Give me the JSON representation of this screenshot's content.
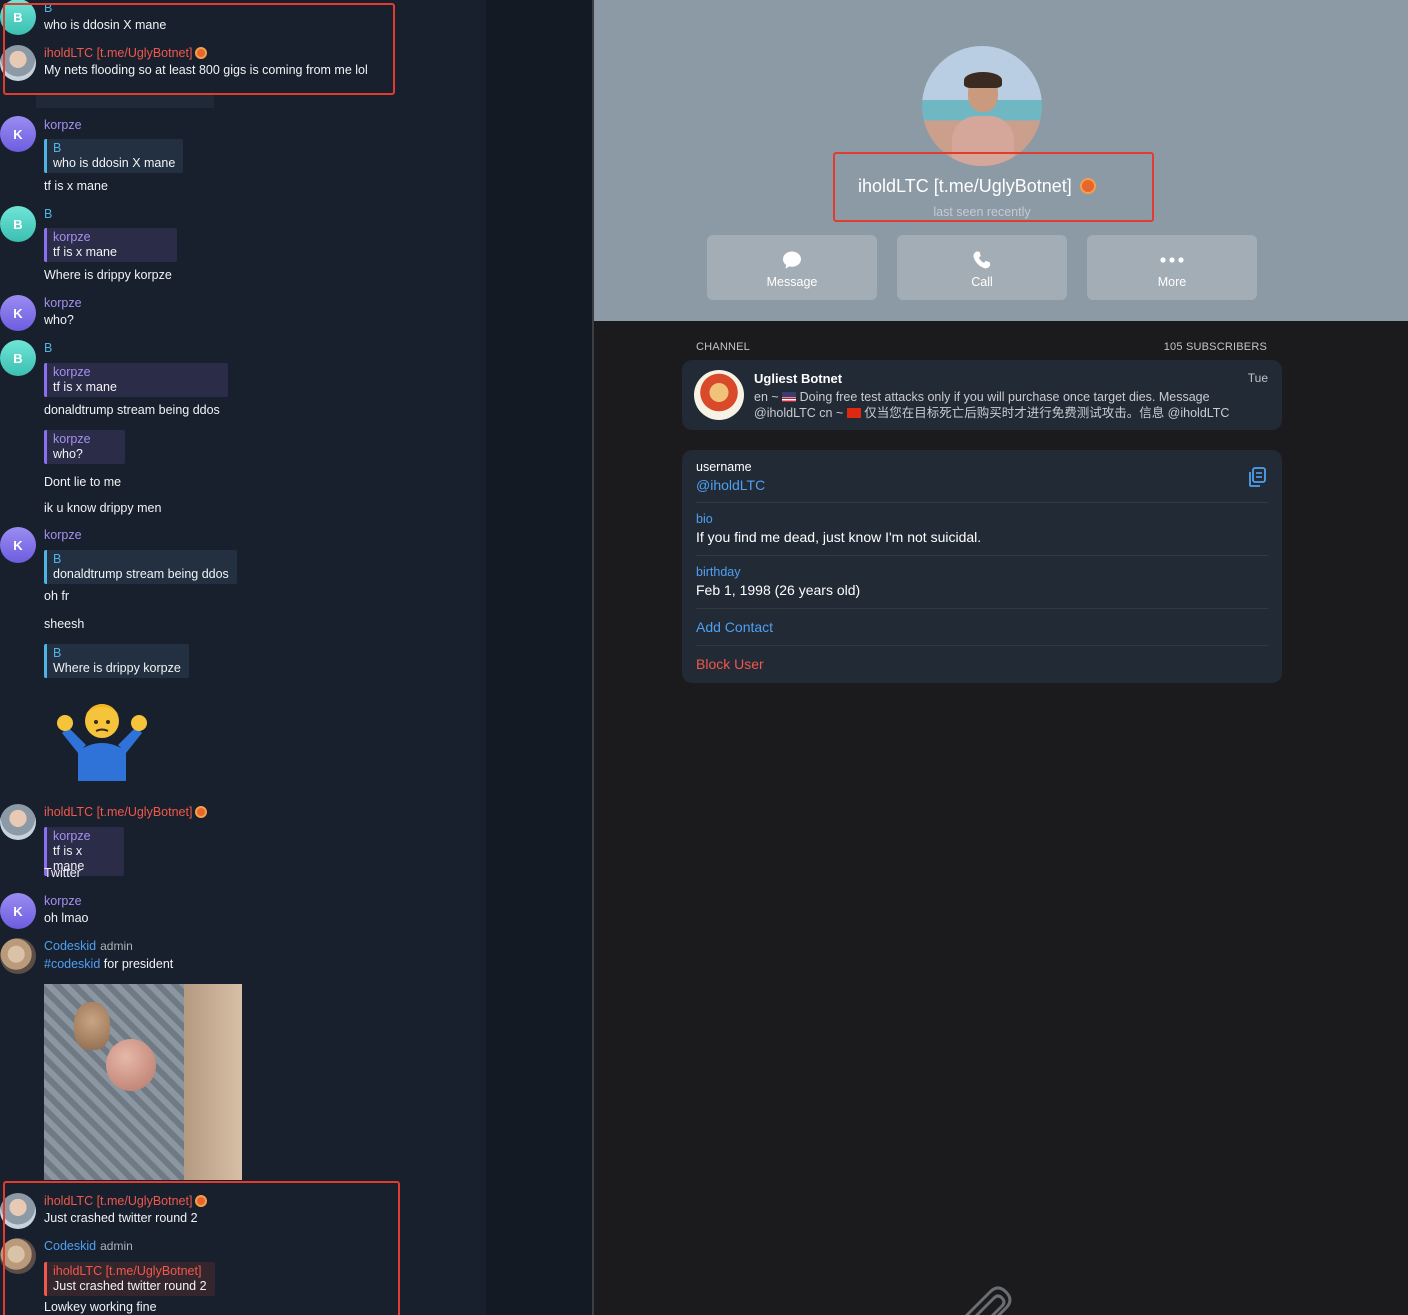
{
  "chat": {
    "messages": [
      {
        "sender": "B",
        "text": "who is ddosin X mane"
      },
      {
        "sender": "iholdLTC [t.me/UglyBotnet]",
        "text": "My nets flooding so at least 800 gigs is coming from me lol"
      },
      {
        "sender": "korpze",
        "reply_name": "B",
        "reply_text": "who is ddosin X mane",
        "text": "tf is x mane"
      },
      {
        "sender": "B",
        "reply_name": "korpze",
        "reply_text": "tf is x mane",
        "text": "Where is drippy korpze"
      },
      {
        "sender": "korpze",
        "text": "who?"
      },
      {
        "sender": "B",
        "reply_name": "korpze",
        "reply_text": "tf is x mane",
        "text": "donaldtrump stream being ddos"
      },
      {
        "reply_name": "korpze",
        "reply_text": "who?",
        "text": "Dont lie to me"
      },
      {
        "text": "ik u know drippy men"
      },
      {
        "sender": "korpze",
        "reply_name": "B",
        "reply_text": "donaldtrump stream being ddos",
        "text": "oh fr"
      },
      {
        "text": "sheesh"
      },
      {
        "reply_name": "B",
        "reply_text": "Where is drippy korpze"
      },
      {
        "sender": "iholdLTC [t.me/UglyBotnet]",
        "reply_name": "korpze",
        "reply_text": "tf is x mane",
        "text": "Twitter"
      },
      {
        "sender": "korpze",
        "text": "oh lmao"
      },
      {
        "sender": "Codeskid",
        "role": "admin",
        "hashtag": "#codeskid",
        "text": " for president"
      },
      {
        "sender": "iholdLTC [t.me/UglyBotnet]",
        "text": "Just crashed twitter round 2"
      },
      {
        "sender": "Codeskid",
        "role": "admin",
        "reply_name": "iholdLTC [t.me/UglyBotnet]",
        "reply_text": "Just crashed twitter round 2",
        "text": "Lowkey working fine"
      }
    ],
    "avatar_letters": {
      "b": "B",
      "k": "K"
    },
    "sticker_icon": "person-shrugging-icon"
  },
  "profile": {
    "name": "iholdLTC [t.me/UglyBotnet]",
    "status": "last seen recently",
    "actions": {
      "message": "Message",
      "call": "Call",
      "more": "More"
    },
    "channel_label": "CHANNEL",
    "subscribers": "105 SUBSCRIBERS",
    "channel": {
      "title": "Ugliest Botnet",
      "date": "Tue",
      "desc_en_prefix": "en ~ ",
      "desc_en": " Doing free test attacks only if you will purchase once target dies. Message",
      "desc_handle": "@iholdLTC  cn ~ ",
      "desc_cn": " 仅当您在目标死亡后购买时才进行免费测试攻击。信息  @iholdLTC"
    },
    "username_label": "username",
    "username": "@iholdLTC",
    "bio_label": "bio",
    "bio": "If you find me dead, just know I'm not suicidal.",
    "birthday_label": "birthday",
    "birthday": "Feb 1, 1998 (26 years old)",
    "add_contact": "Add Contact",
    "block_user": "Block User"
  },
  "colors": {
    "accent": "#4fa0f2",
    "danger": "#f0584d",
    "highlight": "#e23b30"
  }
}
